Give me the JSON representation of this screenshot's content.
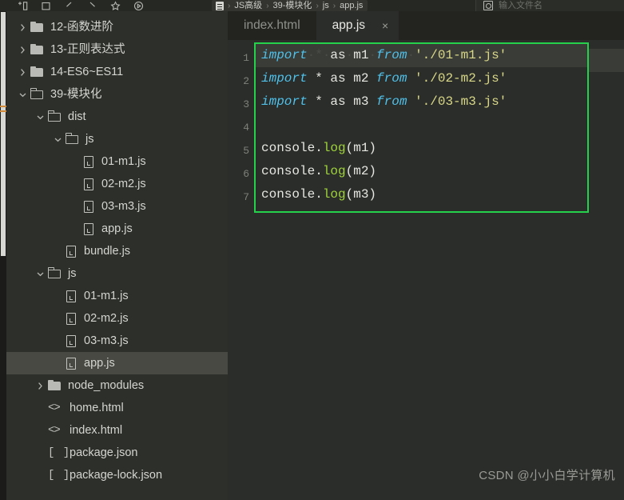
{
  "topbar": {
    "icons": [
      {
        "name": "new-tab-icon",
        "label": "+"
      },
      {
        "name": "stop-square-icon",
        "label": ""
      },
      {
        "name": "back-arrow-icon",
        "label": ""
      },
      {
        "name": "forward-arrow-icon",
        "label": ""
      },
      {
        "name": "star-favorite-icon",
        "label": ""
      },
      {
        "name": "play-circle-icon",
        "label": ""
      }
    ],
    "breadcrumb": [
      "JS高级",
      "39-模块化",
      "js",
      "app.js"
    ],
    "breadcrumb_separator": "›",
    "search_placeholder": "输入文件名"
  },
  "sidebar": {
    "items": [
      {
        "label": "12-函数进阶",
        "type": "folder",
        "depth": 0,
        "chevron": "collapsed",
        "selected": false
      },
      {
        "label": "13-正则表达式",
        "type": "folder",
        "depth": 0,
        "chevron": "collapsed",
        "selected": false
      },
      {
        "label": "14-ES6~ES11",
        "type": "folder",
        "depth": 0,
        "chevron": "collapsed",
        "selected": false
      },
      {
        "label": "39-模块化",
        "type": "folder",
        "depth": 0,
        "chevron": "expanded",
        "selected": false
      },
      {
        "label": "dist",
        "type": "folder",
        "depth": 1,
        "chevron": "expanded",
        "selected": false
      },
      {
        "label": "js",
        "type": "folder",
        "depth": 2,
        "chevron": "expanded",
        "selected": false
      },
      {
        "label": "01-m1.js",
        "type": "js",
        "depth": 3,
        "chevron": "none",
        "selected": false
      },
      {
        "label": "02-m2.js",
        "type": "js",
        "depth": 3,
        "chevron": "none",
        "selected": false
      },
      {
        "label": "03-m3.js",
        "type": "js",
        "depth": 3,
        "chevron": "none",
        "selected": false
      },
      {
        "label": "app.js",
        "type": "js",
        "depth": 3,
        "chevron": "none",
        "selected": false
      },
      {
        "label": "bundle.js",
        "type": "js",
        "depth": 2,
        "chevron": "none",
        "selected": false
      },
      {
        "label": "js",
        "type": "folder",
        "depth": 1,
        "chevron": "expanded",
        "selected": false
      },
      {
        "label": "01-m1.js",
        "type": "js",
        "depth": 2,
        "chevron": "none",
        "selected": false
      },
      {
        "label": "02-m2.js",
        "type": "js",
        "depth": 2,
        "chevron": "none",
        "selected": false
      },
      {
        "label": "03-m3.js",
        "type": "js",
        "depth": 2,
        "chevron": "none",
        "selected": false
      },
      {
        "label": "app.js",
        "type": "js",
        "depth": 2,
        "chevron": "none",
        "selected": true
      },
      {
        "label": "node_modules",
        "type": "folder",
        "depth": 1,
        "chevron": "collapsed",
        "selected": false
      },
      {
        "label": "home.html",
        "type": "html",
        "depth": 1,
        "chevron": "none",
        "selected": false
      },
      {
        "label": "index.html",
        "type": "html",
        "depth": 1,
        "chevron": "none",
        "selected": false
      },
      {
        "label": "package.json",
        "type": "json",
        "depth": 1,
        "chevron": "none",
        "selected": false
      },
      {
        "label": "package-lock.json",
        "type": "json",
        "depth": 1,
        "chevron": "none",
        "selected": false
      }
    ],
    "icon_glyphs": {
      "html": "<>",
      "json": "[ ]"
    }
  },
  "editor": {
    "tabs": [
      {
        "label": "index.html",
        "active": false,
        "closable": false
      },
      {
        "label": "app.js",
        "active": true,
        "closable": true
      }
    ],
    "close_glyph": "×",
    "line_numbers": [
      "1",
      "2",
      "3",
      "4",
      "5",
      "6",
      "7"
    ],
    "code_lines": [
      [
        {
          "t": "import",
          "c": "k-import"
        },
        {
          "t": "·*·",
          "c": "dot"
        },
        {
          "t": "as",
          "c": "k-plain"
        },
        {
          "t": "·",
          "c": "dot"
        },
        {
          "t": "m1",
          "c": "k-plain"
        },
        {
          "t": "·",
          "c": "dot"
        },
        {
          "t": "from",
          "c": "k-import"
        },
        {
          "t": "·",
          "c": "dot"
        },
        {
          "t": "'./01-m1.js'",
          "c": "k-str"
        }
      ],
      [
        {
          "t": "import",
          "c": "k-import"
        },
        {
          "t": " * as m2 ",
          "c": "k-plain"
        },
        {
          "t": "from",
          "c": "k-import"
        },
        {
          "t": " ",
          "c": "k-plain"
        },
        {
          "t": "'./02-m2.js'",
          "c": "k-str"
        }
      ],
      [
        {
          "t": "import",
          "c": "k-import"
        },
        {
          "t": " * as m3 ",
          "c": "k-plain"
        },
        {
          "t": "from",
          "c": "k-import"
        },
        {
          "t": " ",
          "c": "k-plain"
        },
        {
          "t": "'./03-m3.js'",
          "c": "k-str"
        }
      ],
      [],
      [
        {
          "t": "console.",
          "c": "k-plain"
        },
        {
          "t": "log",
          "c": "k-prop"
        },
        {
          "t": "(m1)",
          "c": "k-plain"
        }
      ],
      [
        {
          "t": "console.",
          "c": "k-plain"
        },
        {
          "t": "log",
          "c": "k-prop"
        },
        {
          "t": "(m2)",
          "c": "k-plain"
        }
      ],
      [
        {
          "t": "console.",
          "c": "k-plain"
        },
        {
          "t": "log",
          "c": "k-prop"
        },
        {
          "t": "(m3)",
          "c": "k-plain"
        }
      ]
    ],
    "highlight_border_color": "#25d04a",
    "current_line": 1
  },
  "watermark": "CSDN @小小白学计算机"
}
